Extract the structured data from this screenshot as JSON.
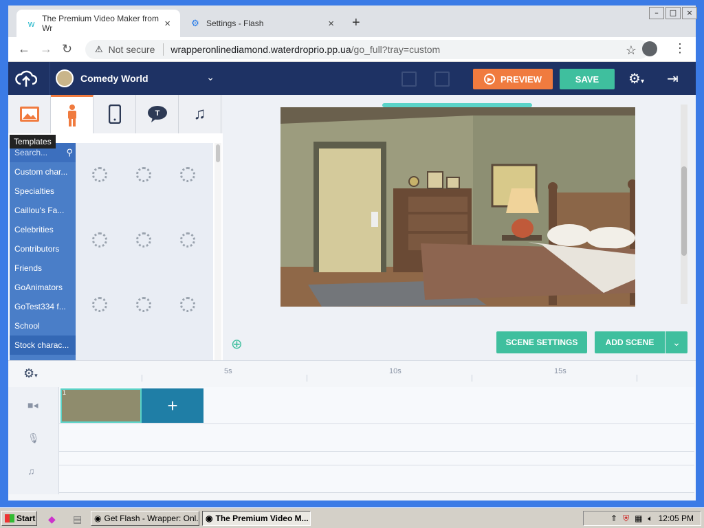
{
  "window": {
    "controls": [
      "–",
      "□",
      "×"
    ]
  },
  "tabs": [
    {
      "title": "The Premium Video Maker from Wr",
      "favicon": "wrapper-logo",
      "active": true
    },
    {
      "title": "Settings - Flash",
      "favicon": "gear",
      "active": false
    }
  ],
  "address": {
    "security_label": "Not secure",
    "domain": "wrapperonlinediamond.waterdroprio.pp.ua",
    "path": "/go_full?tray=custom"
  },
  "header": {
    "theme_name": "Comedy World",
    "preview_label": "PREVIEW",
    "save_label": "SAVE"
  },
  "left_panel": {
    "tooltip": "Templates",
    "search_placeholder": "Search...",
    "categories": [
      "Custom char...",
      "Specialties",
      "Caillou's Fa...",
      "Celebrities",
      "Contributors",
      "Friends",
      "GoAnimators",
      "GoTest334 f...",
      "School",
      "Stock charac..."
    ],
    "selected_category": "Stock charac..."
  },
  "stage": {
    "scene_settings_label": "SCENE SETTINGS",
    "add_scene_label": "ADD SCENE"
  },
  "timeline": {
    "ticks": [
      "5s",
      "10s",
      "15s"
    ],
    "scene_number": "1"
  },
  "taskbar": {
    "start_label": "Start",
    "buttons": [
      {
        "label": "Get Flash - Wrapper: Onl...",
        "active": false
      },
      {
        "label": "The Premium Video M...",
        "active": true
      }
    ],
    "clock": "12:05 PM"
  }
}
